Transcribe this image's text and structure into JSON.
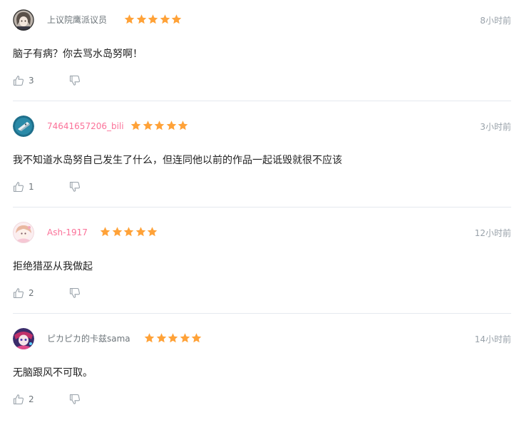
{
  "colors": {
    "star": "#ffa238",
    "username_default": "#6d757a",
    "username_vip": "#fb7299",
    "timestamp": "#99a2aa",
    "action_icon": "#99a2aa",
    "divider": "#e5e9ef"
  },
  "icons": {
    "like": "thumbs-up-icon",
    "dislike": "thumbs-down-icon",
    "rating": "star-icon"
  },
  "reviews": [
    {
      "username": "上议院鹰派议员",
      "username_color": "#6d757a",
      "rating": 5,
      "time": "8小时前",
      "content": "脑子有病？你去骂水岛努啊！",
      "likes": "3"
    },
    {
      "username": "74641657206_bili",
      "username_color": "#fb7299",
      "rating": 5,
      "time": "3小时前",
      "content": "我不知道水岛努自己发生了什么，但连同他以前的作品一起诋毁就很不应该",
      "likes": "1"
    },
    {
      "username": "Ash-1917",
      "username_color": "#fb7299",
      "rating": 5,
      "time": "12小时前",
      "content": "拒绝猎巫从我做起",
      "likes": "2"
    },
    {
      "username": "ピカピカ的卡兹sama",
      "username_color": "#6d757a",
      "rating": 5,
      "time": "14小时前",
      "content": "无脑跟风不可取。",
      "likes": "2"
    }
  ]
}
